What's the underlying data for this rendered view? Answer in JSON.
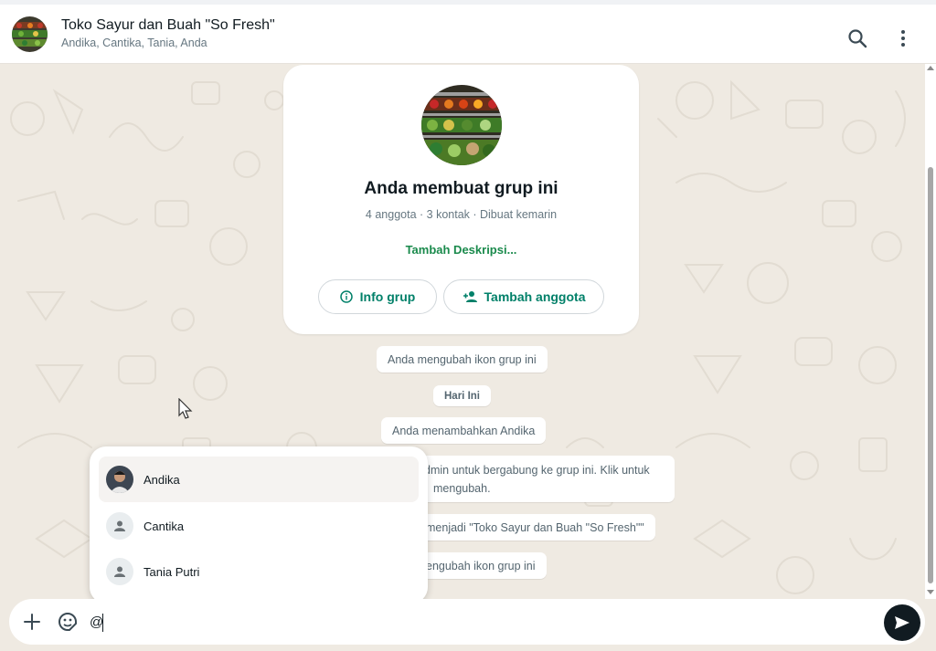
{
  "header": {
    "title": "Toko Sayur dan Buah \"So Fresh\"",
    "members": "Andika, Cantika, Tania, Anda",
    "search_icon": "search-icon",
    "menu_icon": "more-vertical-icon"
  },
  "group_card": {
    "title": "Anda membuat grup ini",
    "meta": "4 anggota · 3 kontak · Dibuat kemarin",
    "add_description": "Tambah Deskripsi...",
    "info_button": "Info grup",
    "add_member_button": "Tambah anggota"
  },
  "system_messages": [
    {
      "text": "Anda mengubah ikon grup ini"
    },
    {
      "text": "Hari Ini",
      "type": "date"
    },
    {
      "text": "Anda menambahkan Andika"
    },
    {
      "text": "dmin untuk bergabung ke grup ini. Klik untuk"
    },
    {
      "text": "mengubah."
    },
    {
      "text": "menjadi \"Toko Sayur dan Buah \"So Fresh\"\""
    },
    {
      "text": "engubah ikon grup ini"
    }
  ],
  "mention_list": [
    {
      "name": "Andika",
      "has_photo": true,
      "selected": true
    },
    {
      "name": "Cantika",
      "has_photo": false,
      "selected": false
    },
    {
      "name": "Tania Putri",
      "has_photo": false,
      "selected": false
    }
  ],
  "composer": {
    "value": "@",
    "plus_icon": "plus-icon",
    "sticker_icon": "sticker-icon",
    "send_icon": "send-icon"
  },
  "colors": {
    "accent_green": "#008069",
    "link_green": "#1a8a4c",
    "chat_background": "#efeae2",
    "send_button": "#111b21"
  }
}
